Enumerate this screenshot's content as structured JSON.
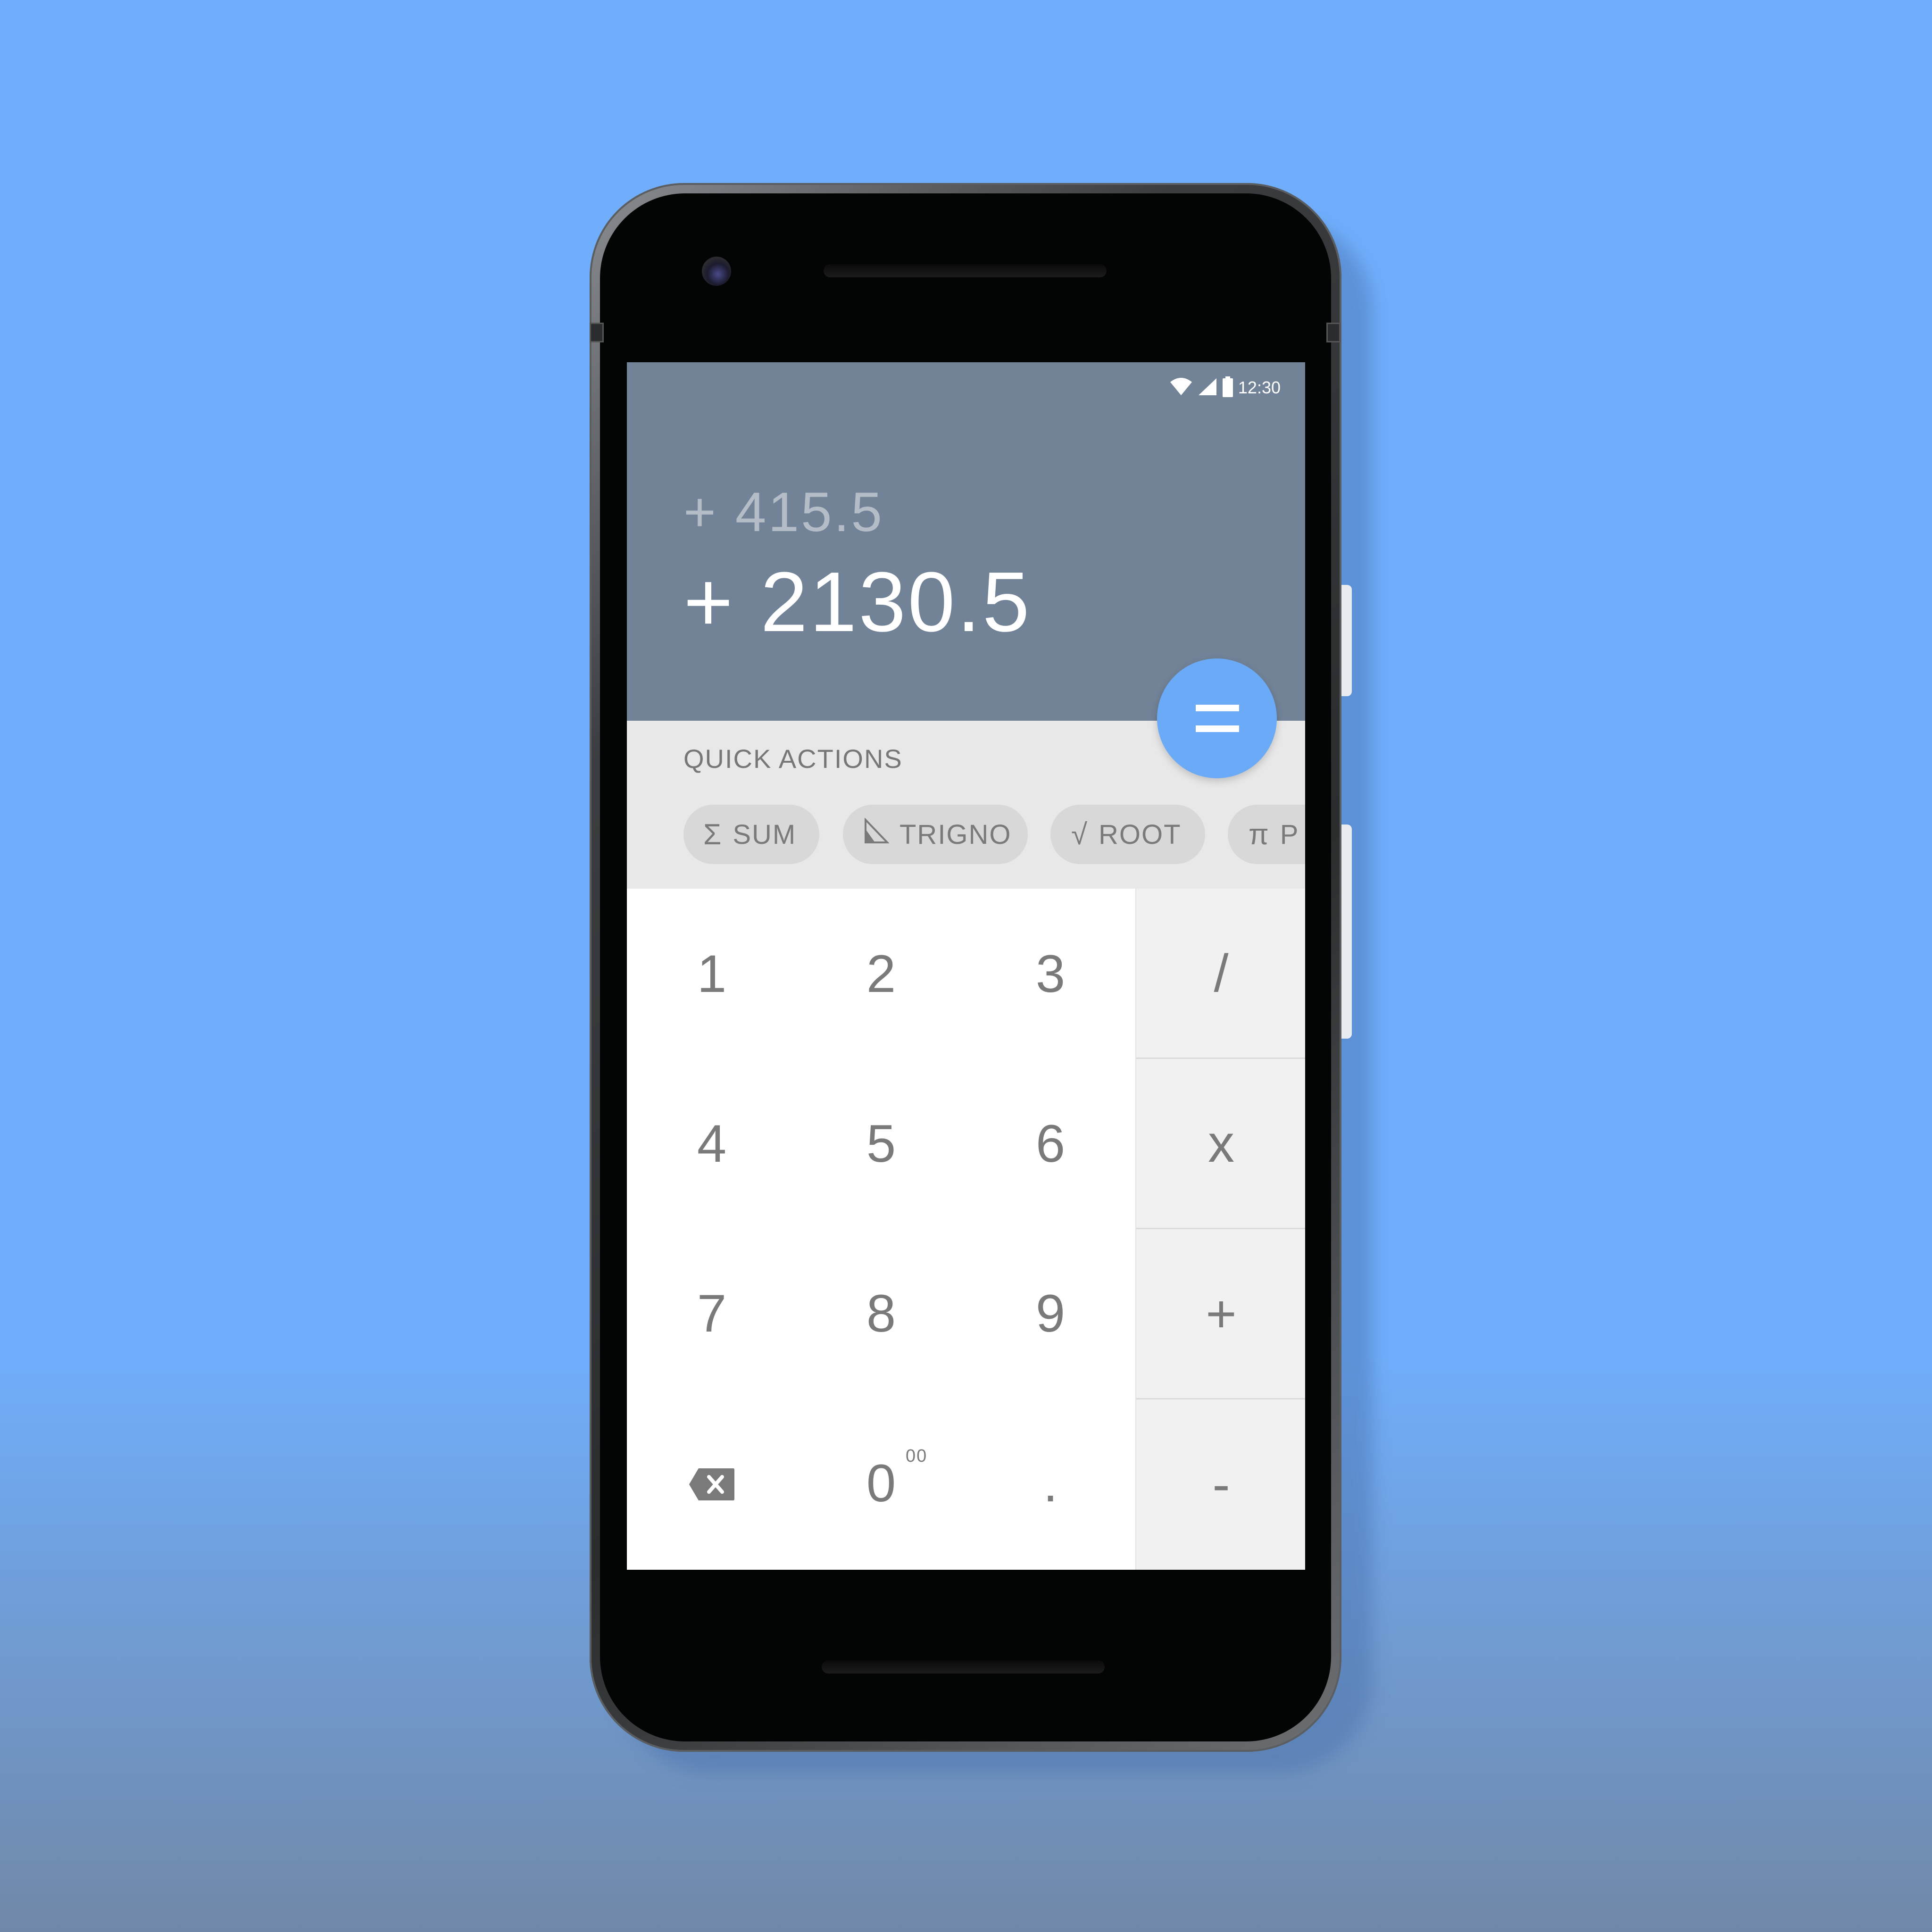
{
  "status_bar": {
    "time": "12:30",
    "icons": [
      "wifi-icon",
      "cell-signal-icon",
      "battery-icon"
    ]
  },
  "display": {
    "previous_entry": "+ 415.5",
    "current_entry": "+ 2130.5"
  },
  "equals_button": {
    "icon": "equals-icon"
  },
  "quick_actions": {
    "title": "QUICK ACTIONS",
    "chips": [
      {
        "label": "SUM",
        "icon": "sigma-icon",
        "glyph": "Σ"
      },
      {
        "label": "TRIGNO",
        "icon": "triangle-icon",
        "glyph": ""
      },
      {
        "label": "ROOT",
        "icon": "root-icon",
        "glyph": "√"
      },
      {
        "label": "P",
        "icon": "pi-icon",
        "glyph": "π"
      }
    ]
  },
  "keypad": {
    "digits": [
      "1",
      "2",
      "3",
      "4",
      "5",
      "6",
      "7",
      "8",
      "9"
    ],
    "backspace_icon": "backspace-icon",
    "zero": "0",
    "zero_secondary": "00",
    "decimal": "."
  },
  "operators": [
    "/",
    "x",
    "+",
    "-"
  ],
  "colors": {
    "background_top": "#70aefc",
    "display_bg": "#728398",
    "accent": "#6aaaf7",
    "quick_panel_bg": "#e8e8e8",
    "operator_bg": "#f1f1f1",
    "key_text": "#7a7a7a"
  }
}
